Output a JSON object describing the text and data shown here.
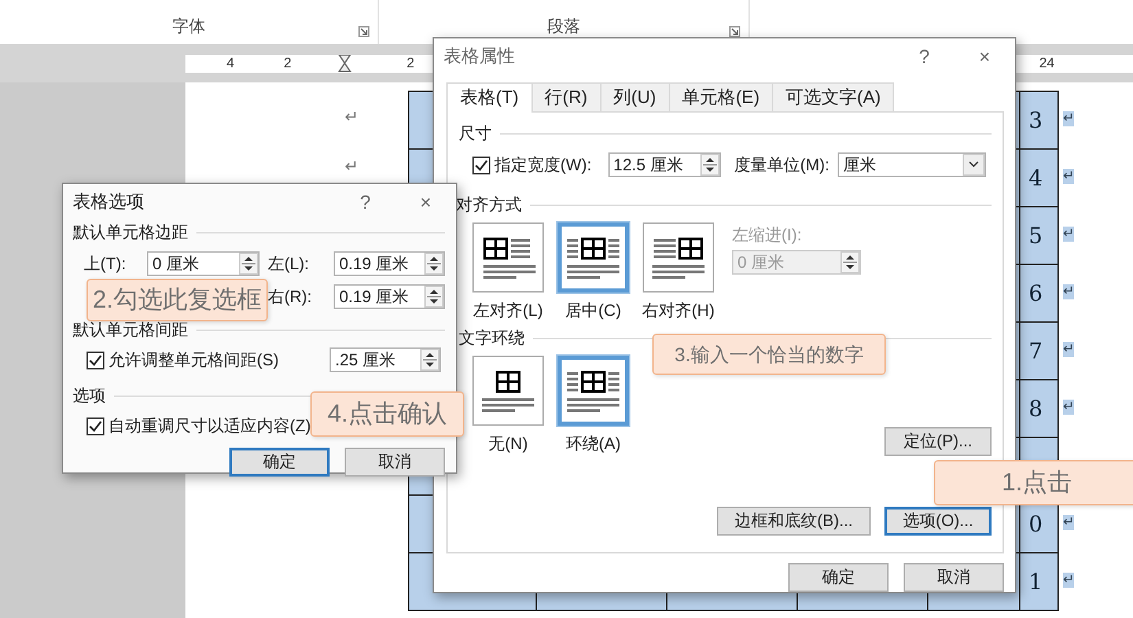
{
  "ribbon": {
    "groups": [
      {
        "label": "字体"
      },
      {
        "label": "段落"
      }
    ]
  },
  "ruler": {
    "labels": [
      "4",
      "2",
      "2",
      "24"
    ]
  },
  "document": {
    "paragraph_marks": [
      "↵",
      "↵"
    ],
    "table": {
      "rows": [
        {
          "last": "3",
          "mark": "↵"
        },
        {
          "last": "4",
          "mark": "↵"
        },
        {
          "last": "5",
          "mark": "↵"
        },
        {
          "last": "6",
          "mark": "↵"
        },
        {
          "last": "7",
          "mark": "↵"
        },
        {
          "last": "8",
          "mark": "↵"
        },
        {},
        {
          "last": "0",
          "mark": "↵"
        },
        {
          "last": "1",
          "mark": "↵"
        }
      ]
    }
  },
  "table_properties_dialog": {
    "title": "表格属性",
    "help": "?",
    "close": "×",
    "tabs": [
      {
        "label": "表格(T)",
        "selected": true
      },
      {
        "label": "行(R)",
        "selected": false
      },
      {
        "label": "列(U)",
        "selected": false
      },
      {
        "label": "单元格(E)",
        "selected": false
      },
      {
        "label": "可选文字(A)",
        "selected": false
      }
    ],
    "size_section": {
      "title": "尺寸",
      "preferred_width": {
        "label": "指定宽度(W):",
        "checked": true,
        "value": "12.5 厘米"
      },
      "unit": {
        "label": "度量单位(M):",
        "value": "厘米"
      }
    },
    "alignment_section": {
      "title": "对齐方式",
      "options": [
        {
          "label": "左对齐(L)",
          "kind": "left",
          "selected": false
        },
        {
          "label": "居中(C)",
          "kind": "center",
          "selected": true
        },
        {
          "label": "右对齐(H)",
          "kind": "right",
          "selected": false
        }
      ],
      "indent": {
        "label": "左缩进(I):",
        "value": "0 厘米",
        "disabled": true
      }
    },
    "wrapping_section": {
      "title": "文字环绕",
      "options": [
        {
          "label": "无(N)",
          "kind": "none",
          "selected": false
        },
        {
          "label": "环绕(A)",
          "kind": "around",
          "selected": true
        }
      ]
    },
    "positioning_button": {
      "label": "定位(P)...",
      "focused": false
    },
    "panel_buttons": [
      {
        "label": "边框和底纹(B)...",
        "focused": false
      },
      {
        "label": "选项(O)...",
        "focused": true
      }
    ],
    "buttons": [
      {
        "label": "确定",
        "focused": false
      },
      {
        "label": "取消",
        "focused": false
      }
    ]
  },
  "table_options_dialog": {
    "title": "表格选项",
    "help": "?",
    "close": "×",
    "margins_section": {
      "title": "默认单元格边距",
      "rows": [
        {
          "left": {
            "label": "上(T):",
            "value": "0 厘米"
          },
          "right": {
            "label": "左(L):",
            "value": "0.19 厘米"
          }
        },
        {
          "right": {
            "label": "右(R):",
            "value": "0.19 厘米"
          }
        }
      ]
    },
    "spacing_section": {
      "title": "默认单元格间距",
      "allow": {
        "label": "允许调整单元格间距(S)",
        "checked": true
      },
      "value": ".25 厘米"
    },
    "options_section": {
      "title": "选项",
      "autofit": {
        "label": "自动重调尺寸以适应内容(Z)",
        "checked": true
      }
    },
    "buttons": [
      {
        "label": "确定",
        "focused": true
      },
      {
        "label": "取消",
        "focused": false
      }
    ]
  },
  "callouts": [
    {
      "text": "2.勾选此复选框"
    },
    {
      "text": "3.输入一个恰当的数字"
    },
    {
      "text": "4.点击确认"
    },
    {
      "text": "1.点击"
    }
  ]
}
